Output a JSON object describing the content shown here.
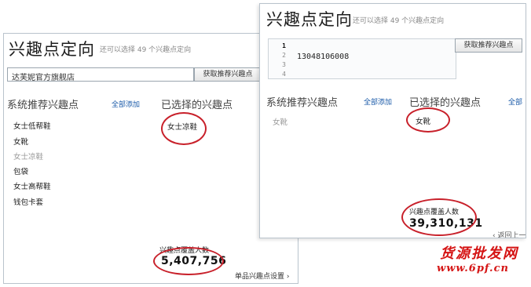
{
  "left_panel": {
    "title": "兴趣点定向",
    "hint": "还可以选择 49 个兴趣点定向",
    "input_value": "达芙妮官方旗舰店",
    "fetch_button": "获取推荐兴趣点",
    "recommend_title": "系统推荐兴趣点",
    "add_all": "全部添加",
    "selected_title": "已选择的兴趣点",
    "recommend_items": [
      {
        "label": "女士低帮鞋",
        "muted": false
      },
      {
        "label": "女靴",
        "muted": false
      },
      {
        "label": "女士凉鞋",
        "muted": true
      },
      {
        "label": "包袋",
        "muted": false
      },
      {
        "label": "女士高帮鞋",
        "muted": false
      },
      {
        "label": "钱包卡套",
        "muted": false
      }
    ],
    "selected_items": [
      "女士凉鞋"
    ],
    "count_label": "兴趣点覆盖人数",
    "count_value": "5,407,756",
    "footer_link": "单品兴趣点设置 ›"
  },
  "right_panel": {
    "title": "兴趣点定向",
    "hint": "还可以选择 49 个兴趣点定向",
    "fetch_button": "获取推荐兴趣点",
    "editor_lines": [
      "1",
      "2",
      "3",
      "4"
    ],
    "editor_text": "13048106008",
    "recommend_title": "系统推荐兴趣点",
    "add_all": "全部添加",
    "selected_title": "已选择的兴趣点",
    "add_all_clipped": "全部",
    "recommend_items": [
      {
        "label": "女靴",
        "muted": true
      }
    ],
    "selected_items": [
      "女靴"
    ],
    "count_label": "兴趣点覆盖人数",
    "count_value": "39,310,131",
    "back_link": "‹ 返回上一"
  },
  "watermark": {
    "text": "货源批发网",
    "url": "www.6pf.cn"
  },
  "colors": {
    "annotation_circle": "#c8202a",
    "link": "#1a5aa8",
    "watermark": "#d51414"
  }
}
